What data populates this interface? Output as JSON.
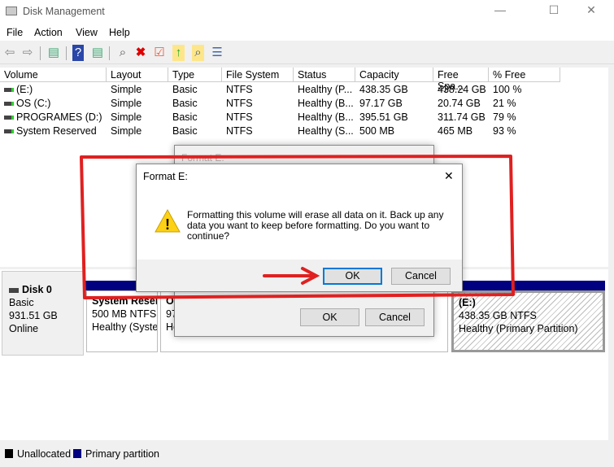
{
  "window": {
    "title": "Disk Management",
    "minimize": "—",
    "maximize": "☐",
    "close": "✕"
  },
  "menu": [
    "File",
    "Action",
    "View",
    "Help"
  ],
  "toolbar": {
    "icons": [
      "back-icon",
      "forward-icon",
      "console-tree-icon",
      "help-icon",
      "action-pane-icon",
      "connect-drive-icon",
      "delete-icon",
      "properties-icon",
      "folder-up-icon",
      "folder-search-icon",
      "checklist-icon"
    ]
  },
  "volumes": {
    "columns": [
      "Volume",
      "Layout",
      "Type",
      "File System",
      "Status",
      "Capacity",
      "Free Spa...",
      "% Free"
    ],
    "rows": [
      [
        "(E:)",
        "Simple",
        "Basic",
        "NTFS",
        "Healthy (P...",
        "438.35 GB",
        "438.24 GB",
        "100 %"
      ],
      [
        "OS (C:)",
        "Simple",
        "Basic",
        "NTFS",
        "Healthy (B...",
        "97.17 GB",
        "20.74 GB",
        "21 %"
      ],
      [
        "PROGRAMES (D:)",
        "Simple",
        "Basic",
        "NTFS",
        "Healthy (B...",
        "395.51 GB",
        "311.74 GB",
        "79 %"
      ],
      [
        "System Reserved",
        "Simple",
        "Basic",
        "NTFS",
        "Healthy (S...",
        "500 MB",
        "465 MB",
        "93 %"
      ]
    ]
  },
  "disk": {
    "name": "Disk 0",
    "type": "Basic",
    "size": "931.51 GB",
    "status": "Online",
    "partitions": [
      {
        "name": "System Reser",
        "size": "500 MB NTFS",
        "status": "Healthy (Syste"
      },
      {
        "name": "OS",
        "size": "97",
        "status": "He"
      },
      {
        "name": "(E:)",
        "size": "438.35 GB NTFS",
        "status": "Healthy (Primary Partition)"
      }
    ]
  },
  "legend": [
    {
      "label": "Unallocated",
      "color": "#000000"
    },
    {
      "label": "Primary partition",
      "color": "#000080"
    }
  ],
  "back_dialog": {
    "title": "Format E:",
    "ok": "OK",
    "cancel": "Cancel"
  },
  "dialog": {
    "title": "Format E:",
    "message": "Formatting this volume will erase all data on it. Back up any data you want to keep before formatting. Do you want to continue?",
    "ok": "OK",
    "cancel": "Cancel",
    "close": "✕",
    "icon": "warning-icon"
  },
  "annotation_color": "#e02020"
}
